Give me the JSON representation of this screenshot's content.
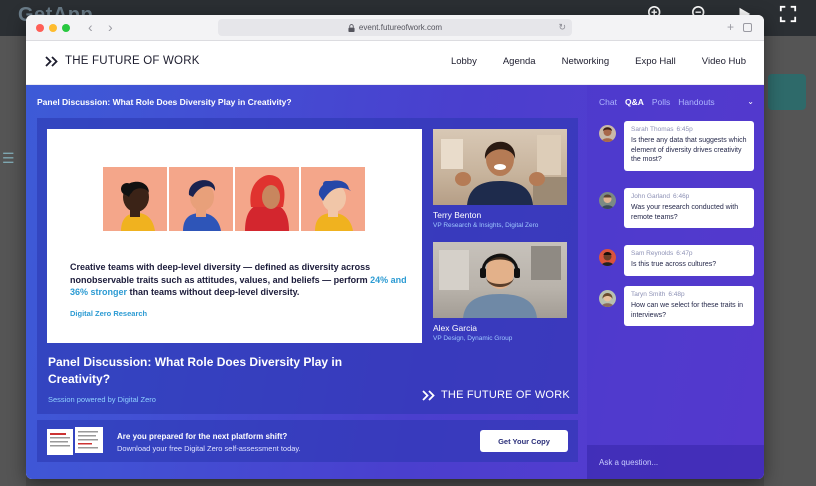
{
  "background_app": {
    "logo": "GetApp"
  },
  "browser": {
    "url": "event.futureofwork.com"
  },
  "site": {
    "brand": "THE FUTURE OF WORK",
    "nav": [
      "Lobby",
      "Agenda",
      "Networking",
      "Expo Hall",
      "Video Hub"
    ]
  },
  "session": {
    "title": "Panel Discussion: What Role Does Diversity Play in Creativity?",
    "slide": {
      "text_before": "Creative teams with deep-level diversity — defined as diversity across nonobservable traits such as attitudes, values, and beliefs — perform ",
      "text_highlight": "24% and 36% stronger",
      "text_after": " than teams without deep-level diversity.",
      "source": "Digital Zero Research"
    },
    "speakers": [
      {
        "name": "Terry Benton",
        "role": "VP Research & Insights, Digital Zero"
      },
      {
        "name": "Alex Garcia",
        "role": "VP Design, Dynamic Group"
      }
    ],
    "stage_title": "Panel Discussion: What Role Does Diversity Play in Creativity?",
    "powered_by": "Session powered by Digital Zero",
    "stage_brand": "THE FUTURE OF WORK"
  },
  "promo": {
    "question": "Are you prepared for the next platform shift?",
    "subtext": "Download your free Digital Zero self-assessment today.",
    "button": "Get Your Copy"
  },
  "sidebar": {
    "tabs": [
      "Chat",
      "Q&A",
      "Polls",
      "Handouts"
    ],
    "active_tab": "Q&A",
    "messages": [
      {
        "name": "Sarah Thomas",
        "time": "6:45p",
        "text": "Is there any data that suggests which element of diversity drives creativity the most?"
      },
      {
        "name": "John Garland",
        "time": "6:46p",
        "text": "Was your research conducted with remote teams?"
      },
      {
        "name": "Sam Reynolds",
        "time": "6:47p",
        "text": "Is this true across cultures?"
      },
      {
        "name": "Taryn Smith",
        "time": "6:48p",
        "text": "How can we select for these traits in interviews?"
      }
    ],
    "ask_placeholder": "Ask a question..."
  },
  "colors": {
    "accent": "#4a3fce",
    "link": "#2c9bd3",
    "face_bg": "#f4a68a"
  }
}
